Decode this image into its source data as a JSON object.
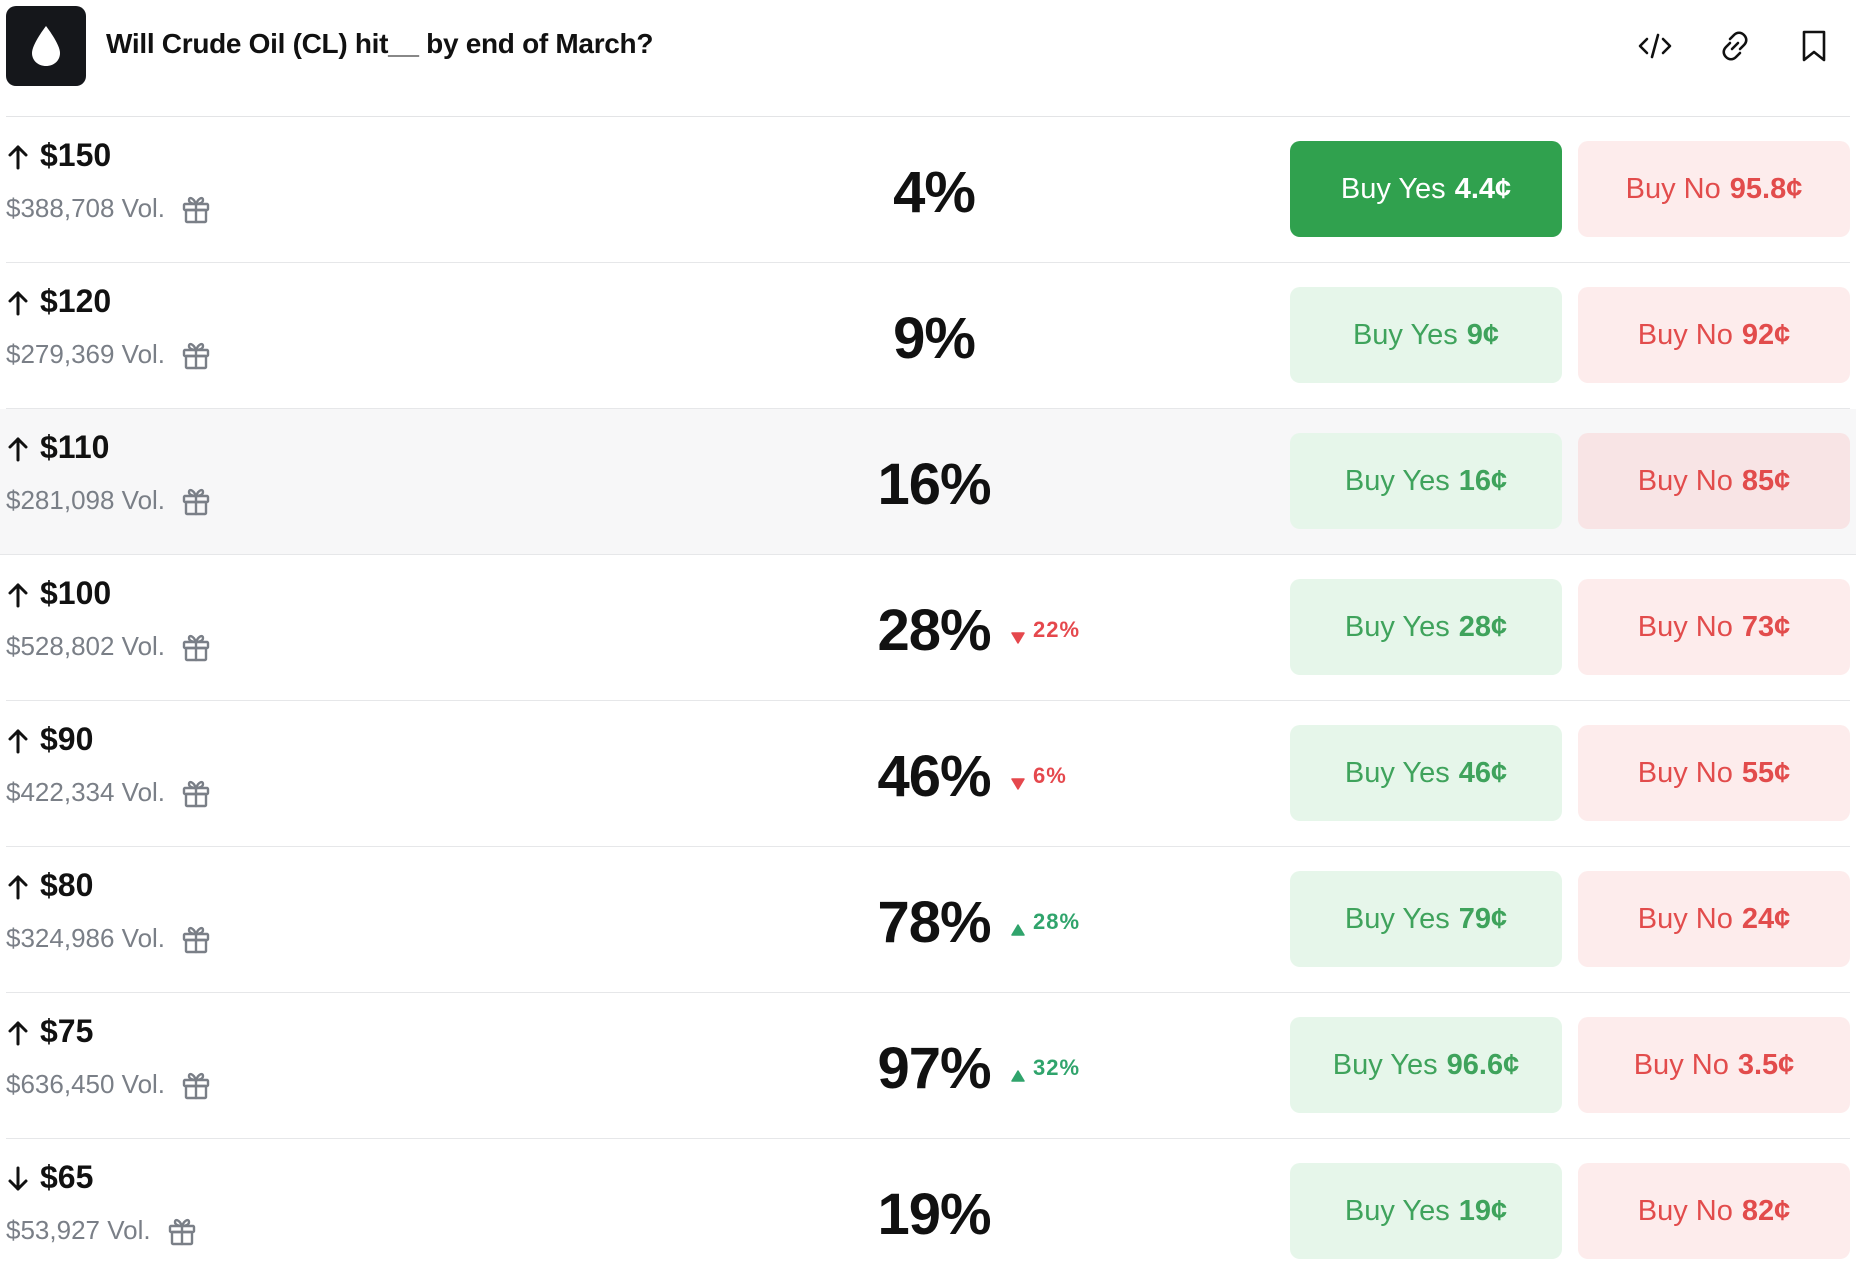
{
  "header": {
    "title": "Will Crude Oil (CL) hit__ by end of March?",
    "logo_icon": "oil-drop-icon",
    "actions": [
      "embed-code-icon",
      "link-icon",
      "bookmark-icon"
    ]
  },
  "colors": {
    "yes_text": "#3fa35c",
    "yes_bg": "#e6f6ea",
    "yes_active_bg": "#30a14e",
    "no_text": "#e24c4c",
    "no_bg": "#fdecec",
    "change_down": "#e5484d",
    "change_up": "#30a46c"
  },
  "markets": [
    {
      "direction": "up",
      "label": "$150",
      "volume": "$388,708 Vol.",
      "probability": "4%",
      "change": "",
      "change_dir": "",
      "yes_label": "Buy Yes",
      "yes_price": "4.4¢",
      "no_label": "Buy No",
      "no_price": "95.8¢",
      "yes_active": true,
      "hovered": false
    },
    {
      "direction": "up",
      "label": "$120",
      "volume": "$279,369 Vol.",
      "probability": "9%",
      "change": "",
      "change_dir": "",
      "yes_label": "Buy Yes",
      "yes_price": "9¢",
      "no_label": "Buy No",
      "no_price": "92¢",
      "yes_active": false,
      "hovered": false
    },
    {
      "direction": "up",
      "label": "$110",
      "volume": "$281,098 Vol.",
      "probability": "16%",
      "change": "",
      "change_dir": "",
      "yes_label": "Buy Yes",
      "yes_price": "16¢",
      "no_label": "Buy No",
      "no_price": "85¢",
      "yes_active": false,
      "hovered": true
    },
    {
      "direction": "up",
      "label": "$100",
      "volume": "$528,802 Vol.",
      "probability": "28%",
      "change": "22%",
      "change_dir": "down",
      "yes_label": "Buy Yes",
      "yes_price": "28¢",
      "no_label": "Buy No",
      "no_price": "73¢",
      "yes_active": false,
      "hovered": false
    },
    {
      "direction": "up",
      "label": "$90",
      "volume": "$422,334 Vol.",
      "probability": "46%",
      "change": "6%",
      "change_dir": "down",
      "yes_label": "Buy Yes",
      "yes_price": "46¢",
      "no_label": "Buy No",
      "no_price": "55¢",
      "yes_active": false,
      "hovered": false
    },
    {
      "direction": "up",
      "label": "$80",
      "volume": "$324,986 Vol.",
      "probability": "78%",
      "change": "28%",
      "change_dir": "up",
      "yes_label": "Buy Yes",
      "yes_price": "79¢",
      "no_label": "Buy No",
      "no_price": "24¢",
      "yes_active": false,
      "hovered": false
    },
    {
      "direction": "up",
      "label": "$75",
      "volume": "$636,450 Vol.",
      "probability": "97%",
      "change": "32%",
      "change_dir": "up",
      "yes_label": "Buy Yes",
      "yes_price": "96.6¢",
      "no_label": "Buy No",
      "no_price": "3.5¢",
      "yes_active": false,
      "hovered": false
    },
    {
      "direction": "down",
      "label": "$65",
      "volume": "$53,927 Vol.",
      "probability": "19%",
      "change": "",
      "change_dir": "",
      "yes_label": "Buy Yes",
      "yes_price": "19¢",
      "no_label": "Buy No",
      "no_price": "82¢",
      "yes_active": false,
      "hovered": false
    }
  ]
}
